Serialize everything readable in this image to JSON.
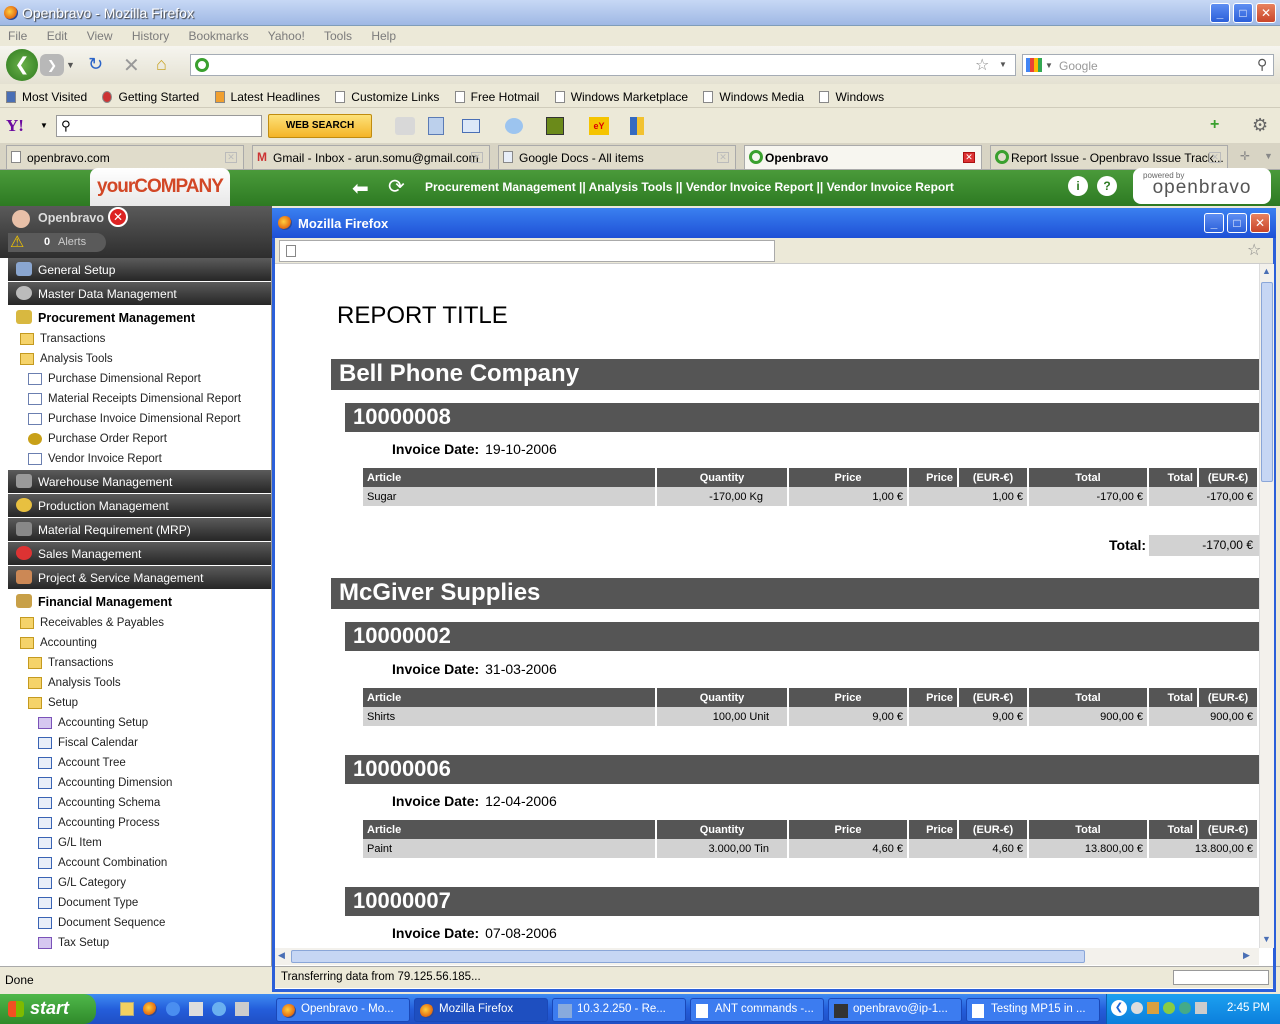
{
  "browser": {
    "title": "Openbravo - Mozilla Firefox",
    "menu": [
      "File",
      "Edit",
      "View",
      "History",
      "Bookmarks",
      "Yahoo!",
      "Tools",
      "Help"
    ],
    "search_placeholder": "Google",
    "bookmarks": [
      "Most Visited",
      "Getting Started",
      "Latest Headlines",
      "Customize Links",
      "Free Hotmail",
      "Windows Marketplace",
      "Windows Media",
      "Windows"
    ],
    "yahoo_search_label": "WEB SEARCH",
    "tabs": [
      {
        "label": "openbravo.com"
      },
      {
        "label": "Gmail - Inbox - arun.somu@gmail.com"
      },
      {
        "label": "Google Docs - All items"
      },
      {
        "label": "Openbravo"
      },
      {
        "label": "Report Issue - Openbravo Issue Track..."
      }
    ],
    "status": "Done"
  },
  "app": {
    "company_logo": "yourCOMPANY",
    "breadcrumb": "Procurement Management || Analysis Tools || Vendor Invoice Report  ||  Vendor Invoice Report",
    "powered_by": "powered by",
    "brand": "openbravo",
    "user": "Openbravo",
    "alerts_count": "0",
    "alerts_label": "Alerts"
  },
  "sidebar": {
    "sections": [
      "General Setup",
      "Master Data Management",
      "Procurement Management",
      "Warehouse Management",
      "Production Management",
      "Material Requirement (MRP)",
      "Sales Management",
      "Project & Service Management",
      "Financial Management"
    ],
    "procurement_items": [
      "Transactions",
      "Analysis Tools",
      "Purchase Dimensional Report",
      "Material Receipts Dimensional Report",
      "Purchase Invoice Dimensional Report",
      "Purchase Order Report",
      "Vendor Invoice Report"
    ],
    "financial_items": [
      "Receivables & Payables",
      "Accounting",
      "Transactions",
      "Analysis Tools",
      "Setup",
      "Accounting Setup",
      "Fiscal Calendar",
      "Account Tree",
      "Accounting Dimension",
      "Accounting Schema",
      "Accounting Process",
      "G/L Item",
      "Account Combination",
      "G/L Category",
      "Document Type",
      "Document Sequence",
      "Tax Setup"
    ]
  },
  "popup": {
    "title": "Mozilla Firefox",
    "status": "Transferring data from 79.125.56.185...",
    "report_title": "REPORT TITLE",
    "invoice_date_label": "Invoice Date:",
    "total_label": "Total:",
    "headers": [
      "Article",
      "Quantity",
      "Price",
      "Price",
      "(EUR-€)",
      "Total",
      "Total",
      "(EUR-€)"
    ],
    "vendors": [
      {
        "name": "Bell Phone Company",
        "invoices": [
          {
            "number": "10000008",
            "date": "19-10-2006",
            "row": [
              "Sugar",
              "-170,00 Kg",
              "1,00  €",
              "1,00  €",
              "-170,00  €",
              "-170,00  €"
            ]
          }
        ],
        "total": "-170,00  €"
      },
      {
        "name": "McGiver Supplies",
        "invoices": [
          {
            "number": "10000002",
            "date": "31-03-2006",
            "row": [
              "Shirts",
              "100,00 Unit",
              "9,00  €",
              "9,00  €",
              "900,00  €",
              "900,00  €"
            ]
          },
          {
            "number": "10000006",
            "date": "12-04-2006",
            "row": [
              "Paint",
              "3.000,00 Tin",
              "4,60  €",
              "4,60  €",
              "13.800,00  €",
              "13.800,00  €"
            ]
          },
          {
            "number": "10000007",
            "date": "07-08-2006"
          }
        ]
      }
    ]
  },
  "taskbar": {
    "start": "start",
    "buttons": [
      "Openbravo - Mo...",
      "Mozilla Firefox",
      "10.3.2.250 - Re...",
      "ANT commands -...",
      "openbravo@ip-1...",
      "Testing MP15 in ..."
    ],
    "clock": "2:45 PM"
  },
  "colors": {
    "report_bar": "#555555",
    "cell_bg": "#d2d2d2",
    "openbravo_green": "#2d7a22",
    "xp_blue": "#245edb"
  }
}
